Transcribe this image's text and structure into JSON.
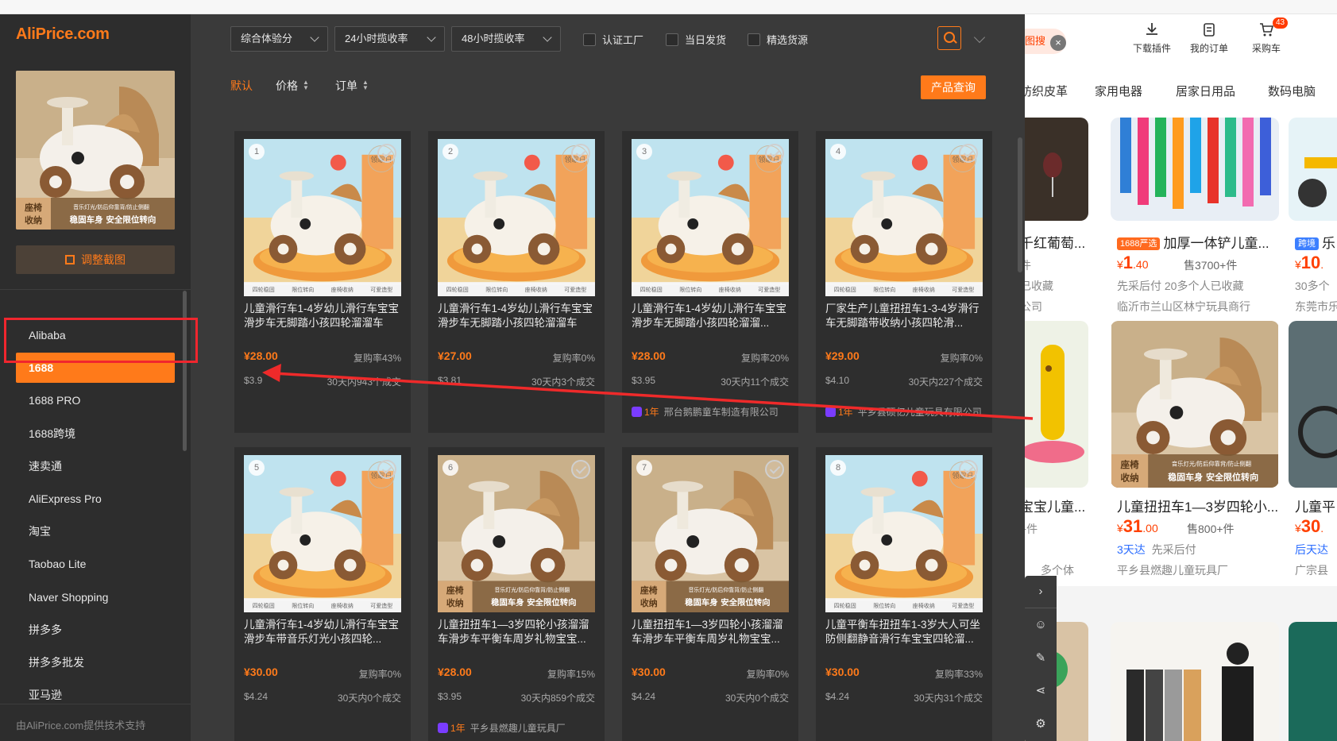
{
  "brand": "AliPrice.com",
  "adjust_button": "调整截图",
  "footer": "由AliPrice.com提供技术支持",
  "sources": [
    "Alibaba",
    "1688",
    "1688 PRO",
    "1688跨境",
    "速卖通",
    "AliExpress Pro",
    "淘宝",
    "Taobao Lite",
    "Naver Shopping",
    "拼多多",
    "拼多多批发",
    "亚马逊"
  ],
  "active_source": "1688",
  "filters": {
    "selects": [
      "综合体验分",
      "24小时揽收率",
      "48小时揽收率"
    ],
    "checkboxes": [
      "认证工厂",
      "当日发货",
      "精选货源"
    ]
  },
  "sort": {
    "default": "默认",
    "price": "价格",
    "orders": "订单",
    "query_button": "产品查询"
  },
  "thumb_caption": {
    "left_top": "座椅",
    "left_bottom": "收纳",
    "right_top": "音乐灯光/防后仰靠背/防止侧翻",
    "right_bottom": "稳固车身 安全限位转向"
  },
  "thumb_stamp": "领取日",
  "thumb_strip": [
    "四轮稳固",
    "限位转向",
    "座椅收纳",
    "可爱造型"
  ],
  "products": [
    {
      "num": "1",
      "title": "儿童滑行车1-4岁幼儿滑行车宝宝滑步车无脚踏小孩四轮溜溜车",
      "price": "¥28.00",
      "rebuy": "复购率43%",
      "usd": "$3.9",
      "deals": "30天内943个成交",
      "supplier_year": "",
      "supplier": ""
    },
    {
      "num": "2",
      "title": "儿童滑行车1-4岁幼儿滑行车宝宝滑步车无脚踏小孩四轮溜溜车",
      "price": "¥27.00",
      "rebuy": "复购率0%",
      "usd": "$3.81",
      "deals": "30天内3个成交",
      "supplier_year": "",
      "supplier": ""
    },
    {
      "num": "3",
      "title": "儿童滑行车1-4岁幼儿滑行车宝宝滑步车无脚踏小孩四轮溜溜...",
      "price": "¥28.00",
      "rebuy": "复购率20%",
      "usd": "$3.95",
      "deals": "30天内11个成交",
      "supplier_year": "1年",
      "supplier": "邢台鹅鹏童车制造有限公司"
    },
    {
      "num": "4",
      "title": "厂家生产儿童扭扭车1-3-4岁滑行车无脚踏带收纳小孩四轮滑...",
      "price": "¥29.00",
      "rebuy": "复购率0%",
      "usd": "$4.10",
      "deals": "30天内227个成交",
      "supplier_year": "1年",
      "supplier": "平乡县硕亿儿童玩具有限公司"
    },
    {
      "num": "5",
      "title": "儿童滑行车1-4岁幼儿滑行车宝宝滑步车带音乐灯光小孩四轮...",
      "price": "¥30.00",
      "rebuy": "复购率0%",
      "usd": "$4.24",
      "deals": "30天内0个成交",
      "supplier_year": "",
      "supplier": ""
    },
    {
      "num": "6",
      "title": "儿童扭扭车1—3岁四轮小孩溜溜车滑步车平衡车周岁礼物宝宝...",
      "price": "¥28.00",
      "rebuy": "复购率15%",
      "usd": "$3.95",
      "deals": "30天内859个成交",
      "supplier_year": "1年",
      "supplier": "平乡县燃趣儿童玩具厂"
    },
    {
      "num": "7",
      "title": "儿童扭扭车1—3岁四轮小孩溜溜车滑步车平衡车周岁礼物宝宝...",
      "price": "¥30.00",
      "rebuy": "复购率0%",
      "usd": "$4.24",
      "deals": "30天内0个成交",
      "supplier_year": "",
      "supplier": ""
    },
    {
      "num": "8",
      "title": "儿童平衡车扭扭车1-3岁大人可坐防侧翻静音滑行车宝宝四轮溜...",
      "price": "¥30.00",
      "rebuy": "复购率33%",
      "usd": "$4.24",
      "deals": "30天内31个成交",
      "supplier_year": "",
      "supplier": ""
    }
  ],
  "background_page": {
    "pill": "图搜",
    "tools": [
      {
        "label": "下载插件",
        "icon": "download-icon"
      },
      {
        "label": "我的订单",
        "icon": "clipboard-icon"
      },
      {
        "label": "采购车",
        "icon": "cart-icon",
        "badge": "43"
      }
    ],
    "nav": [
      "纺织皮革",
      "家用电器",
      "居家日用品",
      "数码电脑"
    ],
    "row1": {
      "col0": {
        "title": "千红葡萄...",
        "line1": "件",
        "line2": "已收藏",
        "line3": "公司"
      },
      "col1": {
        "tag": "1688严选",
        "title": "加厚一体铲儿童...",
        "price_int": "1",
        "price_dec": ".40",
        "sold": "售3700+件",
        "line2": "先采后付  20多个人已收藏",
        "line3": "临沂市兰山区林宁玩具商行"
      },
      "col2": {
        "tag": "跨境",
        "title": "乐",
        "price_int": "10",
        "price_dec": ".",
        "line2": "30多个",
        "line3": "东莞市乐"
      }
    },
    "row2": {
      "col0": {
        "title": "宝宝儿童...",
        "line1": "+件",
        "line2": "多个体"
      },
      "col1": {
        "title": "儿童扭扭车1—3岁四轮小...",
        "price_int": "31",
        "price_dec": ".00",
        "sold": "售800+件",
        "badge": "3天达",
        "line2": "先采后付",
        "line3": "平乡县燃趣儿童玩具厂"
      },
      "col2": {
        "title": "儿童平",
        "price_int": "30",
        "price_dec": ".",
        "badge": "后天达",
        "line3": "广宗县"
      }
    }
  },
  "colors": {
    "accent": "#ff7a1a",
    "annotation": "#f0262e",
    "overlay_bg": "#3a3a3a"
  }
}
